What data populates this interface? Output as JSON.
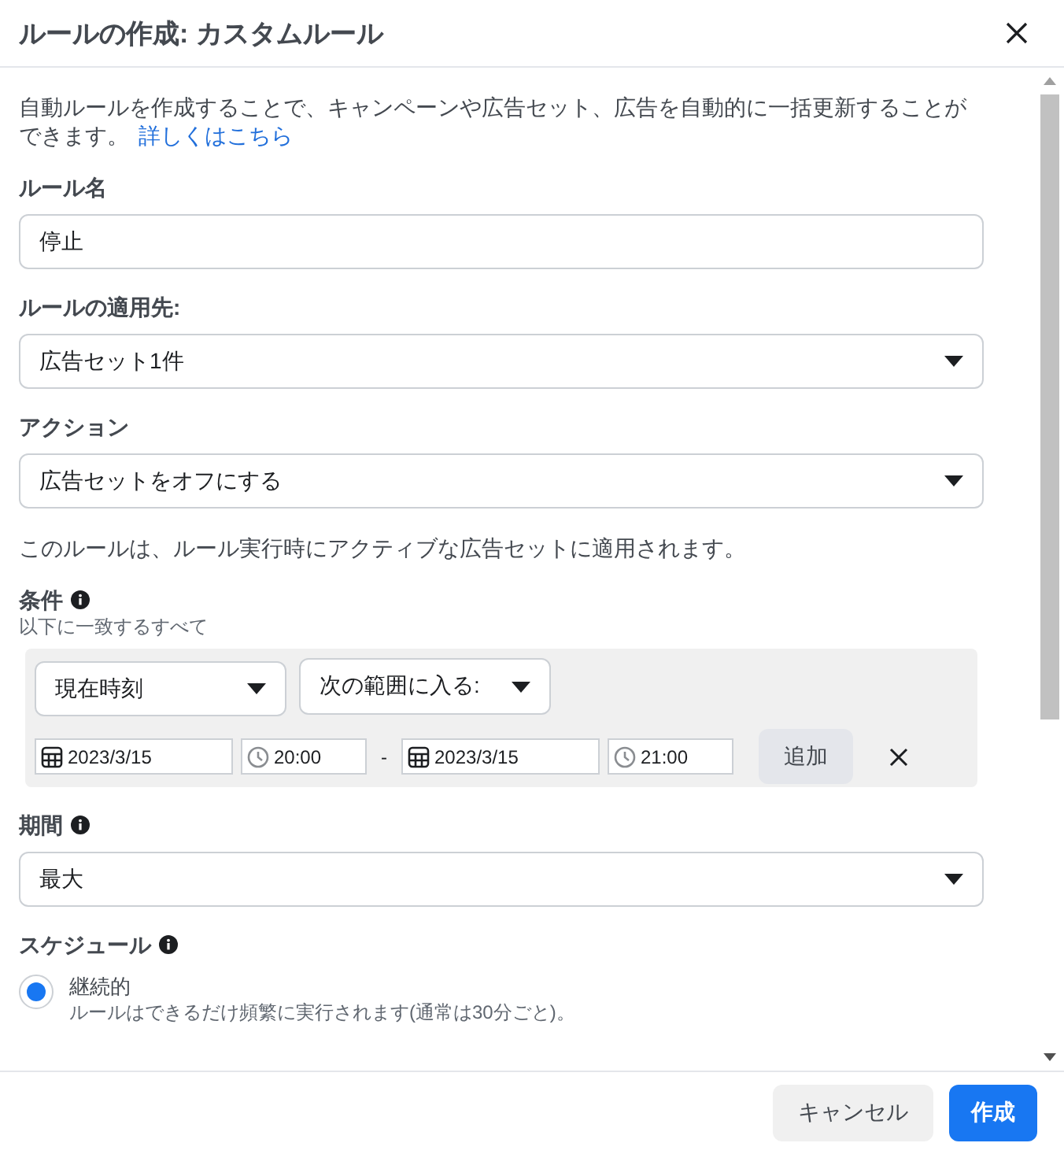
{
  "dialog": {
    "title": "ルールの作成: カスタムルール"
  },
  "intro": {
    "text": "自動ルールを作成することで、キャンペーンや広告セット、広告を自動的に一括更新することができます。",
    "link": "詳しくはこちら"
  },
  "fields": [
    {
      "kind": "text",
      "label": "ルール名",
      "value": "停止"
    },
    {
      "kind": "select",
      "label": "ルールの適用先:",
      "value": "広告セット1件"
    },
    {
      "kind": "select",
      "label": "アクション",
      "value": "広告セットをオフにする"
    }
  ],
  "action_note": "このルールは、ルール実行時にアクティブな広告セットに適用されます。",
  "conditions": {
    "label": "条件",
    "info": true,
    "subtitle": "以下に一致するすべて",
    "metric": "現在時刻",
    "operator": "次の範囲に入る:",
    "start_date": "2023/3/15",
    "start_time": "20:00",
    "separator": "-",
    "end_date": "2023/3/15",
    "end_time": "21:00",
    "add_button": "追加"
  },
  "period": {
    "label": "期間",
    "info": true,
    "value": "最大"
  },
  "schedule": {
    "label": "スケジュール",
    "info": true,
    "options": [
      {
        "label": "継続的",
        "description": "ルールはできるだけ頻繁に実行されます(通常は30分ごと)。",
        "selected": true
      }
    ]
  },
  "buttons": [
    {
      "kind": "secondary",
      "label": "キャンセル"
    },
    {
      "kind": "primary",
      "label": "作成"
    }
  ]
}
